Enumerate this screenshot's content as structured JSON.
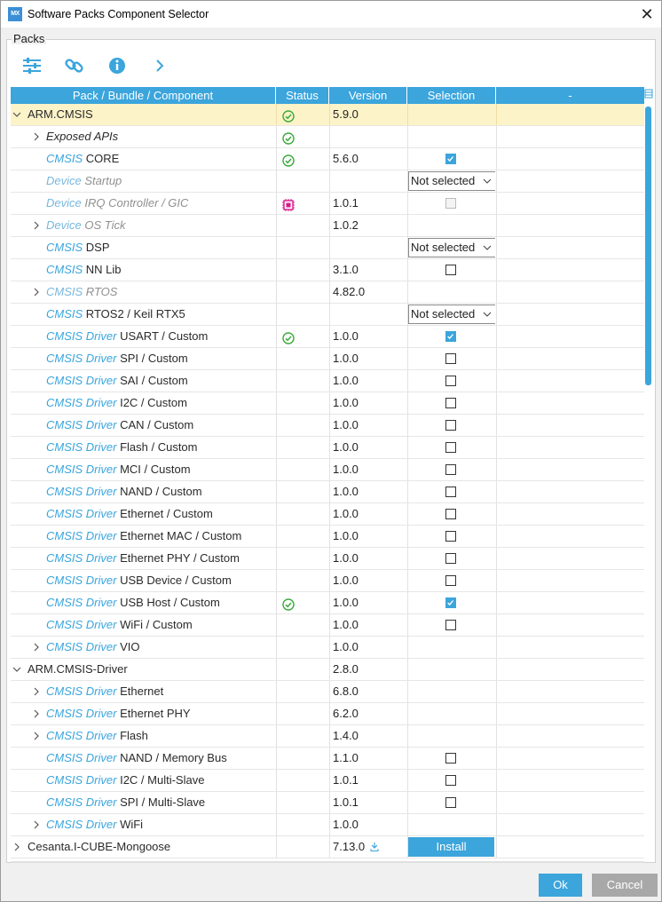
{
  "window": {
    "title": "Software Packs Component Selector",
    "app_badge": "MX",
    "close_glyph": "✕"
  },
  "packs_legend": "Packs",
  "toolbar": [
    {
      "name": "filter-icon"
    },
    {
      "name": "link-icon"
    },
    {
      "name": "info-icon"
    },
    {
      "name": "chevron-right-icon"
    }
  ],
  "columns": [
    "Pack / Bundle / Component",
    "Status",
    "Version",
    "Selection",
    "-"
  ],
  "corner_icon": "expand-columns-icon",
  "colors": {
    "accent": "#3ba5dc",
    "highlight": "#fdf3c8",
    "ok": "#3aaa3a",
    "chip": "#d81b8a"
  },
  "rows": [
    {
      "level": 0,
      "exp": "down",
      "cls": "",
      "grp": "ARM.CMSIS",
      "status": "ok",
      "version": "5.9.0",
      "sel": "",
      "hl": true
    },
    {
      "level": 1,
      "exp": "right",
      "cls": "",
      "grp": "Exposed APIs",
      "italic": true,
      "status": "ok",
      "version": "",
      "sel": ""
    },
    {
      "level": 1,
      "exp": "",
      "cls": "CMSIS",
      "grp": "CORE",
      "status": "ok",
      "version": "5.6.0",
      "sel": "on"
    },
    {
      "level": 1,
      "exp": "",
      "cls": "Device",
      "grp": "Startup",
      "dis": true,
      "status": "",
      "version": "",
      "sel": "dd"
    },
    {
      "level": 1,
      "exp": "",
      "cls": "Device",
      "grp": "IRQ Controller / GIC",
      "dis": true,
      "status": "chip",
      "version": "1.0.1",
      "sel": "off"
    },
    {
      "level": 1,
      "exp": "right",
      "cls": "Device",
      "grp": "OS Tick",
      "dis": true,
      "status": "",
      "version": "1.0.2",
      "sel": ""
    },
    {
      "level": 1,
      "exp": "",
      "cls": "CMSIS",
      "grp": "DSP",
      "status": "",
      "version": "",
      "sel": "dd"
    },
    {
      "level": 1,
      "exp": "",
      "cls": "CMSIS",
      "grp": "NN Lib",
      "status": "",
      "version": "3.1.0",
      "sel": "empty"
    },
    {
      "level": 1,
      "exp": "right",
      "cls": "CMSIS",
      "grp": "RTOS",
      "dis": true,
      "status": "",
      "version": "4.82.0",
      "sel": ""
    },
    {
      "level": 1,
      "exp": "",
      "cls": "CMSIS",
      "grp": "RTOS2 / Keil RTX5",
      "status": "",
      "version": "",
      "sel": "dd"
    },
    {
      "level": 1,
      "exp": "",
      "cls": "CMSIS Driver",
      "grp": "USART / Custom",
      "status": "ok",
      "version": "1.0.0",
      "sel": "on"
    },
    {
      "level": 1,
      "exp": "",
      "cls": "CMSIS Driver",
      "grp": "SPI / Custom",
      "status": "",
      "version": "1.0.0",
      "sel": "empty"
    },
    {
      "level": 1,
      "exp": "",
      "cls": "CMSIS Driver",
      "grp": "SAI / Custom",
      "status": "",
      "version": "1.0.0",
      "sel": "empty"
    },
    {
      "level": 1,
      "exp": "",
      "cls": "CMSIS Driver",
      "grp": "I2C / Custom",
      "status": "",
      "version": "1.0.0",
      "sel": "empty"
    },
    {
      "level": 1,
      "exp": "",
      "cls": "CMSIS Driver",
      "grp": "CAN / Custom",
      "status": "",
      "version": "1.0.0",
      "sel": "empty"
    },
    {
      "level": 1,
      "exp": "",
      "cls": "CMSIS Driver",
      "grp": "Flash / Custom",
      "status": "",
      "version": "1.0.0",
      "sel": "empty"
    },
    {
      "level": 1,
      "exp": "",
      "cls": "CMSIS Driver",
      "grp": "MCI / Custom",
      "status": "",
      "version": "1.0.0",
      "sel": "empty"
    },
    {
      "level": 1,
      "exp": "",
      "cls": "CMSIS Driver",
      "grp": "NAND / Custom",
      "status": "",
      "version": "1.0.0",
      "sel": "empty"
    },
    {
      "level": 1,
      "exp": "",
      "cls": "CMSIS Driver",
      "grp": "Ethernet / Custom",
      "status": "",
      "version": "1.0.0",
      "sel": "empty"
    },
    {
      "level": 1,
      "exp": "",
      "cls": "CMSIS Driver",
      "grp": "Ethernet MAC / Custom",
      "status": "",
      "version": "1.0.0",
      "sel": "empty"
    },
    {
      "level": 1,
      "exp": "",
      "cls": "CMSIS Driver",
      "grp": "Ethernet PHY / Custom",
      "status": "",
      "version": "1.0.0",
      "sel": "empty"
    },
    {
      "level": 1,
      "exp": "",
      "cls": "CMSIS Driver",
      "grp": "USB Device / Custom",
      "status": "",
      "version": "1.0.0",
      "sel": "empty"
    },
    {
      "level": 1,
      "exp": "",
      "cls": "CMSIS Driver",
      "grp": "USB Host / Custom",
      "status": "ok",
      "version": "1.0.0",
      "sel": "on"
    },
    {
      "level": 1,
      "exp": "",
      "cls": "CMSIS Driver",
      "grp": "WiFi / Custom",
      "status": "",
      "version": "1.0.0",
      "sel": "empty"
    },
    {
      "level": 1,
      "exp": "right",
      "cls": "CMSIS Driver",
      "grp": "VIO",
      "status": "",
      "version": "1.0.0",
      "sel": ""
    },
    {
      "level": 0,
      "exp": "down",
      "cls": "",
      "grp": "ARM.CMSIS-Driver",
      "status": "",
      "version": "2.8.0",
      "sel": ""
    },
    {
      "level": 1,
      "exp": "right",
      "cls": "CMSIS Driver",
      "grp": "Ethernet",
      "status": "",
      "version": "6.8.0",
      "sel": ""
    },
    {
      "level": 1,
      "exp": "right",
      "cls": "CMSIS Driver",
      "grp": "Ethernet PHY",
      "status": "",
      "version": "6.2.0",
      "sel": ""
    },
    {
      "level": 1,
      "exp": "right",
      "cls": "CMSIS Driver",
      "grp": "Flash",
      "status": "",
      "version": "1.4.0",
      "sel": ""
    },
    {
      "level": 1,
      "exp": "",
      "cls": "CMSIS Driver",
      "grp": "NAND / Memory Bus",
      "status": "",
      "version": "1.1.0",
      "sel": "empty"
    },
    {
      "level": 1,
      "exp": "",
      "cls": "CMSIS Driver",
      "grp": "I2C / Multi-Slave",
      "status": "",
      "version": "1.0.1",
      "sel": "empty"
    },
    {
      "level": 1,
      "exp": "",
      "cls": "CMSIS Driver",
      "grp": "SPI / Multi-Slave",
      "status": "",
      "version": "1.0.1",
      "sel": "empty"
    },
    {
      "level": 1,
      "exp": "right",
      "cls": "CMSIS Driver",
      "grp": "WiFi",
      "status": "",
      "version": "1.0.0",
      "sel": ""
    },
    {
      "level": 0,
      "exp": "right",
      "cls": "",
      "grp": "Cesanta.I-CUBE-Mongoose",
      "status": "",
      "version": "7.13.0",
      "download": true,
      "sel": "install"
    }
  ],
  "dropdown_label": "Not selected",
  "dropdown_arrow": "⌵",
  "install_label": "Install",
  "footer": {
    "ok_label": "Ok",
    "cancel_label": "Cancel"
  }
}
